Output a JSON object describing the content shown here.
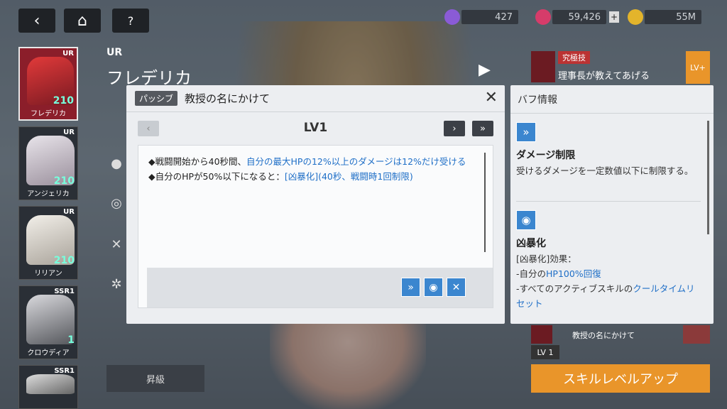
{
  "colors": {
    "accent_blue": "#1f6fc7",
    "buff_icon_bg": "#3b86cf",
    "orange": "#e9952a",
    "dialog_bg": "#eceef1"
  },
  "topbar": {
    "back_icon": "back-arrow-icon",
    "home_icon": "home-icon",
    "help_icon": "help-icon",
    "resources": [
      {
        "icon": "gem-icon",
        "value": "427"
      },
      {
        "icon": "crystal-icon",
        "value": "59,426"
      },
      {
        "icon": "coin-icon",
        "value": "55M"
      }
    ]
  },
  "character": {
    "rarity": "UR",
    "name": "フレデリカ"
  },
  "roster": [
    {
      "rank": "UR",
      "level": "210",
      "name": "フレデリカ"
    },
    {
      "rank": "UR",
      "level": "210",
      "name": "アンジェリカ"
    },
    {
      "rank": "UR",
      "level": "210",
      "name": "リリアン"
    },
    {
      "rank": "SSR1",
      "level": "1",
      "name": "クロウディア"
    },
    {
      "rank": "SSR1",
      "level": "",
      "name": ""
    }
  ],
  "dialog": {
    "tag": "パッシブ",
    "title": "教授の名にかけて",
    "level": "LV1",
    "desc_line1_prefix": "◆戦闘開始から40秒間、",
    "desc_line1_hl": "自分の最大HPの12%以上のダメージは12%だけ受ける",
    "desc_line2_prefix": "◆自分のHPが50%以下になると：",
    "desc_line2_hl": "[凶暴化](40秒、戦闘時1回制限)",
    "buff_icons": [
      "damage-limit-icon",
      "berserk-icon",
      "crossed-swords-icon"
    ]
  },
  "buff_panel": {
    "title": "バフ情報",
    "items": [
      {
        "icon": "damage-limit-icon",
        "name": "ダメージ制限",
        "desc": "受けるダメージを一定数値以下に制限する。"
      },
      {
        "icon": "berserk-icon",
        "name": "凶暴化",
        "desc_line1": "[凶暴化]効果：",
        "desc_line2_prefix": "-自分の",
        "desc_line2_hl": "HP100%回復",
        "desc_line3_prefix": "-すべてのアクティブスキルの",
        "desc_line3_hl": "クールタイムリセット"
      }
    ]
  },
  "right": {
    "ult_tag": "究極技",
    "ult_sub": "理事長が教えてあげる",
    "lv_plus": "LV+",
    "skill_name": "教授の名にかけて",
    "skill_lv": "LV 1",
    "level_up": "スキルレベルアップ"
  },
  "promote": "昇級"
}
